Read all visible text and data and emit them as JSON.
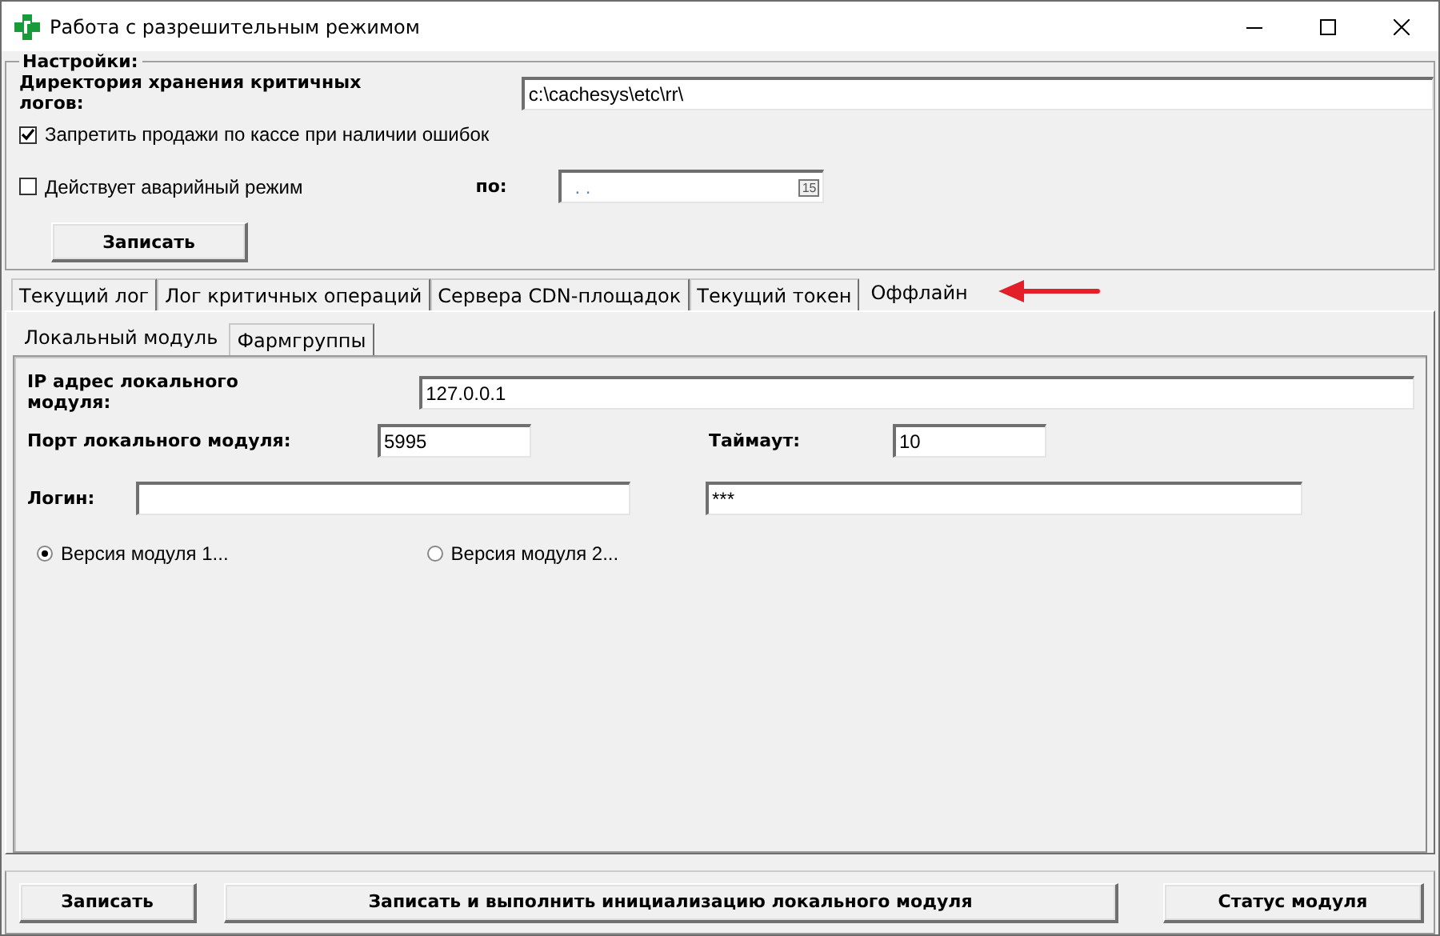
{
  "window": {
    "title": "Работа с разрешительным режимом"
  },
  "settings": {
    "title": "Настройки:",
    "log_dir": {
      "label": "Директория хранения критичных логов:",
      "value": "c:\\cachesys\\etc\\rr\\"
    },
    "options": [
      {
        "label": "Запретить продажи по кассе при наличии ошибок",
        "checked": true
      },
      {
        "label": "Действует аварийный режим",
        "checked": false
      }
    ],
    "until": {
      "label": "по:",
      "value": ". .",
      "calendar_button": "15"
    },
    "save_button": "Записать"
  },
  "tabs": [
    {
      "label": "Текущий лог",
      "selected": false
    },
    {
      "label": "Лог критичных операций",
      "selected": false
    },
    {
      "label": "Сервера CDN-площадок",
      "selected": false
    },
    {
      "label": "Текущий токен",
      "selected": false
    },
    {
      "label": "Оффлайн",
      "selected": true
    }
  ],
  "subtabs": [
    {
      "label": "Локальный модуль",
      "selected": true
    },
    {
      "label": "Фармгруппы",
      "selected": false
    }
  ],
  "local_module": {
    "ip": {
      "label": "IP адрес локального модуля:",
      "value": "127.0.0.1"
    },
    "port": {
      "label": "Порт локального модуля:",
      "value": "5995"
    },
    "timeout": {
      "label": "Таймаут:",
      "value": "10"
    },
    "login": {
      "label": "Логин:"
    },
    "password": {
      "value": "***"
    },
    "versions": [
      {
        "label": "Версия модуля 1...",
        "selected": true
      },
      {
        "label": "Версия модуля 2...",
        "selected": false
      }
    ]
  },
  "buttons": [
    "Записать",
    "Записать и выполнить инициализацию локального модуля",
    "Статус модуля"
  ],
  "annotations": [
    {
      "kind": "arrow"
    }
  ]
}
